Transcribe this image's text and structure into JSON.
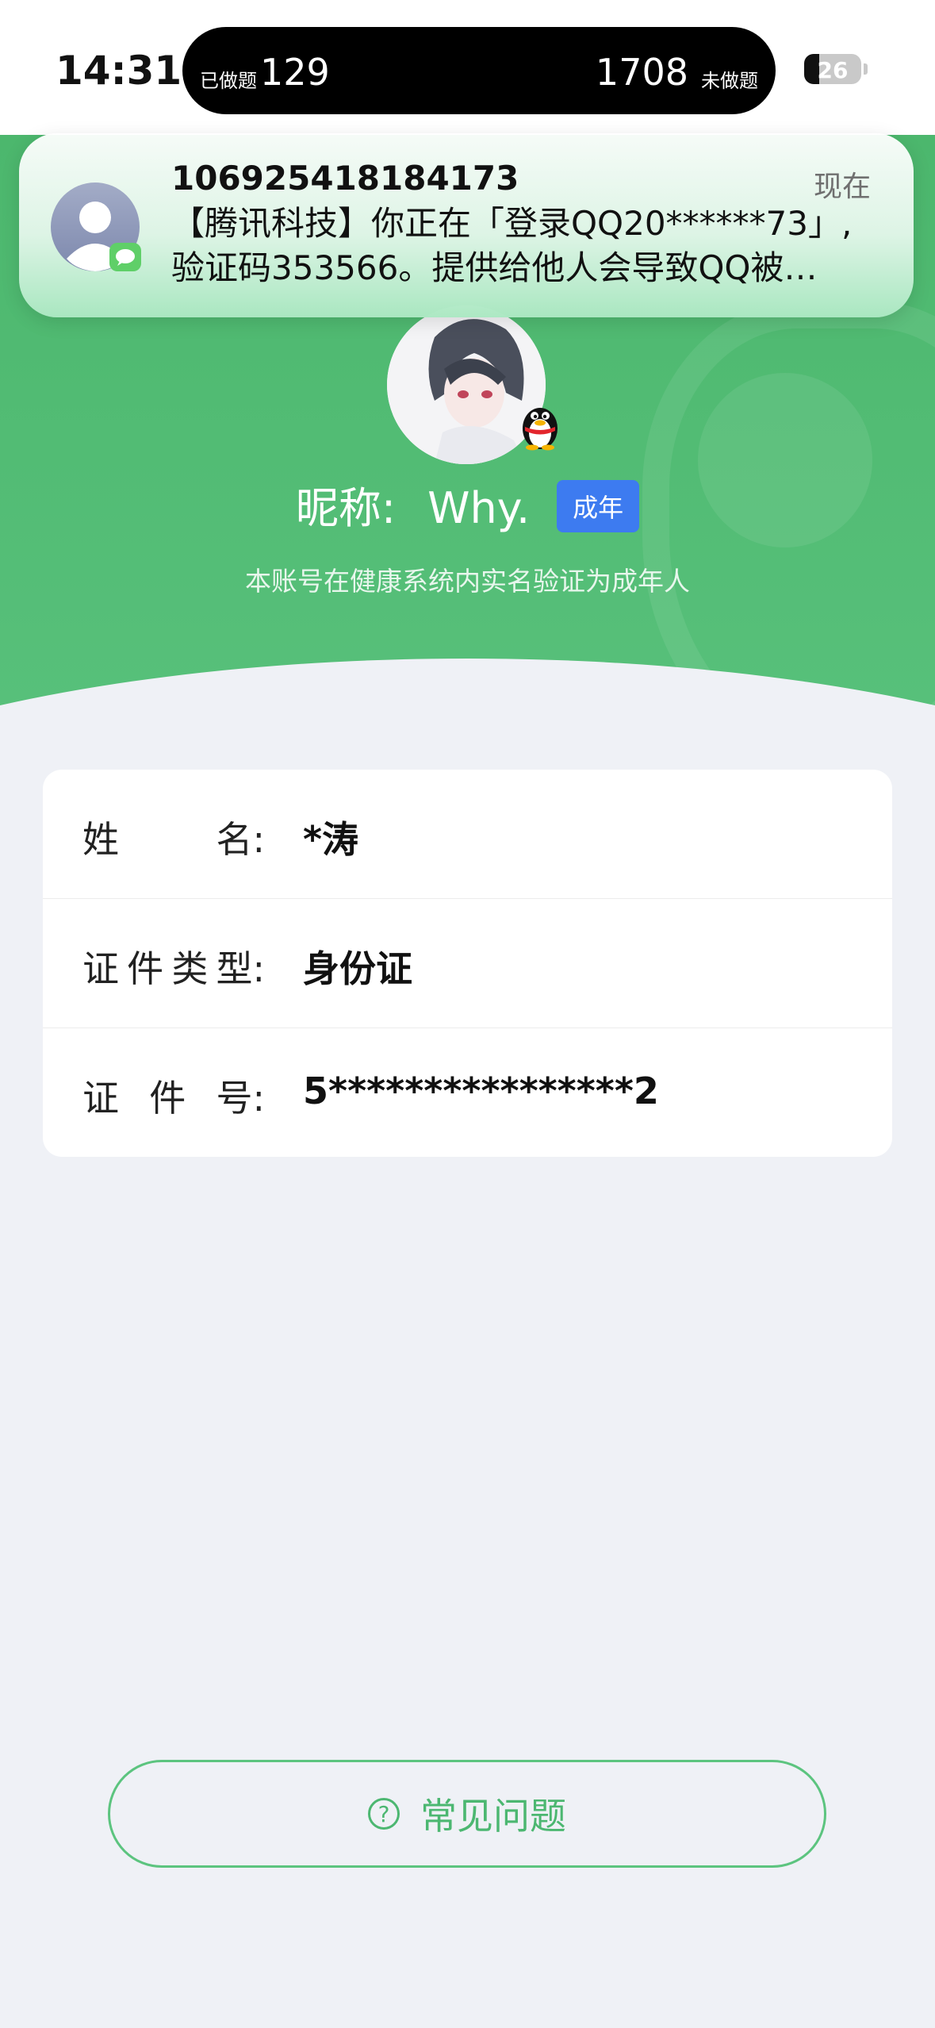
{
  "status_bar": {
    "time": "14:31",
    "island": {
      "done_label": "已做题",
      "done_value": "129",
      "todo_value": "1708",
      "todo_label": "未做题"
    },
    "battery": "26"
  },
  "notification": {
    "sender": "106925418184173",
    "time": "现在",
    "line1": "【腾讯科技】你正在「登录QQ20******73」,",
    "line2": "验证码353566。提供给他人会导致QQ被…"
  },
  "profile": {
    "nickname_label": "昵称:",
    "nickname": "Why.",
    "age_badge": "成年",
    "verify_text": "本账号在健康系统内实名验证为成年人"
  },
  "info": {
    "rows": [
      {
        "label": [
          "姓",
          "名:"
        ],
        "value": "*涛"
      },
      {
        "label": [
          "证",
          "件",
          "类",
          "型:"
        ],
        "value": "身份证"
      },
      {
        "label": [
          "证",
          "件",
          "号:"
        ],
        "value": "5****************2"
      }
    ]
  },
  "faq": {
    "label": "常见问题",
    "icon": "question-circle-icon",
    "accent_color": "#4cb771"
  }
}
